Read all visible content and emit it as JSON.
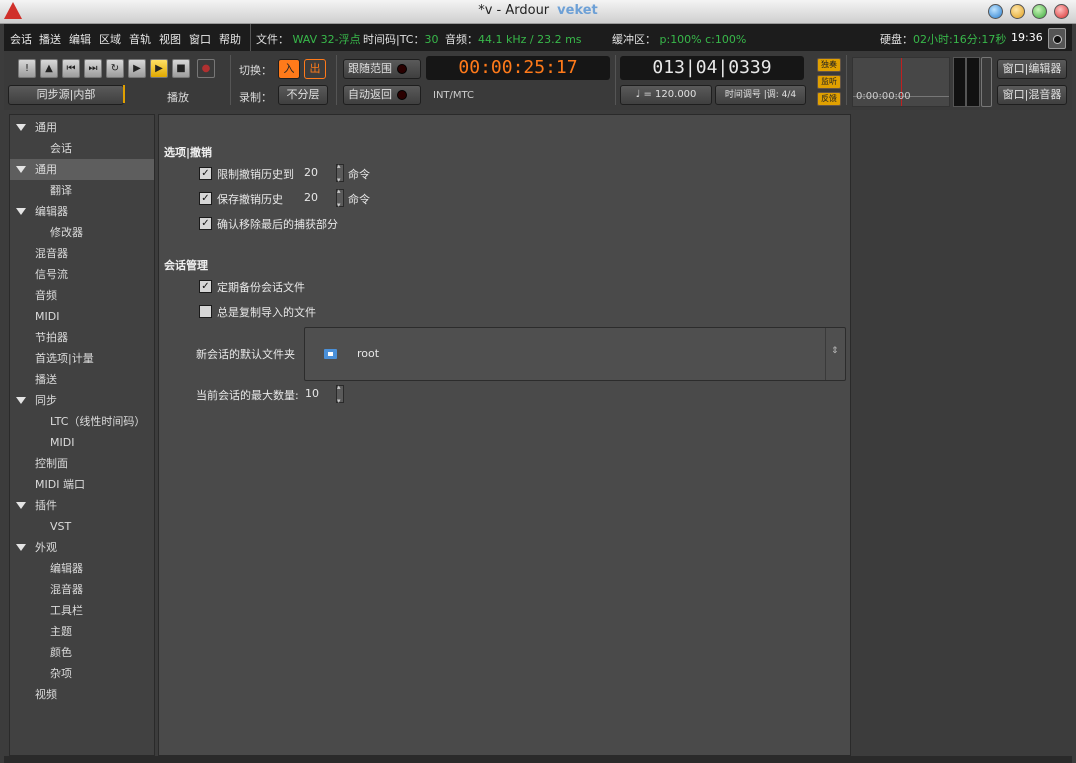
{
  "window": {
    "title": "*v - Ardour",
    "title_suffix": "veket",
    "buttons": [
      "minimize-icon",
      "shade-icon",
      "maximize-icon",
      "close-icon"
    ]
  },
  "menu": {
    "items": [
      "会话",
      "播送",
      "编辑",
      "区域",
      "音轨",
      "视图",
      "窗口",
      "帮助"
    ]
  },
  "status": {
    "file_label": "文件：",
    "file_value": "WAV 32-浮点",
    "tc_label": "时间码|TC：",
    "tc_value": "30",
    "audio_label": "音频：",
    "audio_value": "44.1 kHz / 23.2 ms",
    "buffer_label": "缓冲区：",
    "buffer_value": "p:100% c:100%",
    "disk_label": "硬盘：",
    "disk_value": "02小时:16分:17秒",
    "time": "19:36"
  },
  "toolbar": {
    "transport_icons": [
      "midi-panic-icon",
      "metronome-icon",
      "go-to-start-icon",
      "go-to-end-icon",
      "loop-icon",
      "play-selection-icon",
      "play-icon",
      "stop-icon",
      "record-icon"
    ],
    "sync_source": "同步源|内部",
    "playback_label": "播放",
    "punch_label": "切换：",
    "punch_in": "入",
    "punch_out": "出",
    "follow_range": "跟随范围",
    "record_label": "录制：",
    "record_mode": "不分层",
    "auto_return": "自动返回",
    "primary_clock": "00:00:25:17",
    "primary_clock_mode": "INT/MTC",
    "secondary_clock": "013|04|0339",
    "tempo": "♩ = 120.000",
    "meter": "时间调号 |调: 4/4",
    "solo": "独奏",
    "audition": "监听",
    "feedback": "反馈",
    "mini_timeline_time": "0:00:00:00",
    "window_editor": "窗口|编辑器",
    "window_mixer": "窗口|混音器"
  },
  "sidebar": {
    "items": [
      {
        "label": "通用",
        "expander": true,
        "indent": 0,
        "selected": false
      },
      {
        "label": "会话",
        "expander": false,
        "indent": 1,
        "selected": false
      },
      {
        "label": "通用",
        "expander": true,
        "indent": 0,
        "selected": true
      },
      {
        "label": "翻译",
        "expander": false,
        "indent": 1,
        "selected": false
      },
      {
        "label": "编辑器",
        "expander": true,
        "indent": 0,
        "selected": false
      },
      {
        "label": "修改器",
        "expander": false,
        "indent": 1,
        "selected": false
      },
      {
        "label": "混音器",
        "expander": false,
        "indent": 0,
        "selected": false
      },
      {
        "label": "信号流",
        "expander": false,
        "indent": 0,
        "selected": false
      },
      {
        "label": "音频",
        "expander": false,
        "indent": 0,
        "selected": false
      },
      {
        "label": "MIDI",
        "expander": false,
        "indent": 0,
        "selected": false
      },
      {
        "label": "节拍器",
        "expander": false,
        "indent": 0,
        "selected": false
      },
      {
        "label": "首选项|计量",
        "expander": false,
        "indent": 0,
        "selected": false
      },
      {
        "label": "播送",
        "expander": false,
        "indent": 0,
        "selected": false
      },
      {
        "label": "同步",
        "expander": true,
        "indent": 0,
        "selected": false
      },
      {
        "label": "LTC（线性时间码）",
        "expander": false,
        "indent": 1,
        "selected": false
      },
      {
        "label": "MIDI",
        "expander": false,
        "indent": 1,
        "selected": false
      },
      {
        "label": "控制面",
        "expander": false,
        "indent": 0,
        "selected": false
      },
      {
        "label": "MIDI 端口",
        "expander": false,
        "indent": 0,
        "selected": false
      },
      {
        "label": "插件",
        "expander": true,
        "indent": 0,
        "selected": false
      },
      {
        "label": "VST",
        "expander": false,
        "indent": 1,
        "selected": false
      },
      {
        "label": "外观",
        "expander": true,
        "indent": 0,
        "selected": false
      },
      {
        "label": "编辑器",
        "expander": false,
        "indent": 1,
        "selected": false
      },
      {
        "label": "混音器",
        "expander": false,
        "indent": 1,
        "selected": false
      },
      {
        "label": "工具栏",
        "expander": false,
        "indent": 1,
        "selected": false
      },
      {
        "label": "主题",
        "expander": false,
        "indent": 1,
        "selected": false
      },
      {
        "label": "颜色",
        "expander": false,
        "indent": 1,
        "selected": false
      },
      {
        "label": "杂项",
        "expander": false,
        "indent": 1,
        "selected": false
      },
      {
        "label": "视频",
        "expander": false,
        "indent": 0,
        "selected": false
      }
    ]
  },
  "main": {
    "undo_section": "选项|撤销",
    "limit_undo": {
      "label": "限制撤销历史到",
      "checked": true,
      "value": "20",
      "unit": "命令"
    },
    "save_undo": {
      "label": "保存撤销历史",
      "checked": true,
      "value": "20",
      "unit": "命令"
    },
    "verify_remove": {
      "label": "确认移除最后的捕获部分",
      "checked": true
    },
    "session_section": "会话管理",
    "periodic_backup": {
      "label": "定期备份会话文件",
      "checked": true
    },
    "always_copy": {
      "label": "总是复制导入的文件",
      "checked": false
    },
    "default_folder": {
      "label": "新会话的默认文件夹",
      "value": "root",
      "icon": "home-folder-icon"
    },
    "max_recent": {
      "label": "当前会话的最大数量:",
      "value": "10"
    }
  },
  "colors": {
    "accent_orange": "#ff7a1a",
    "status_green": "#38b84a",
    "solo_yellow": "#e0a000"
  }
}
